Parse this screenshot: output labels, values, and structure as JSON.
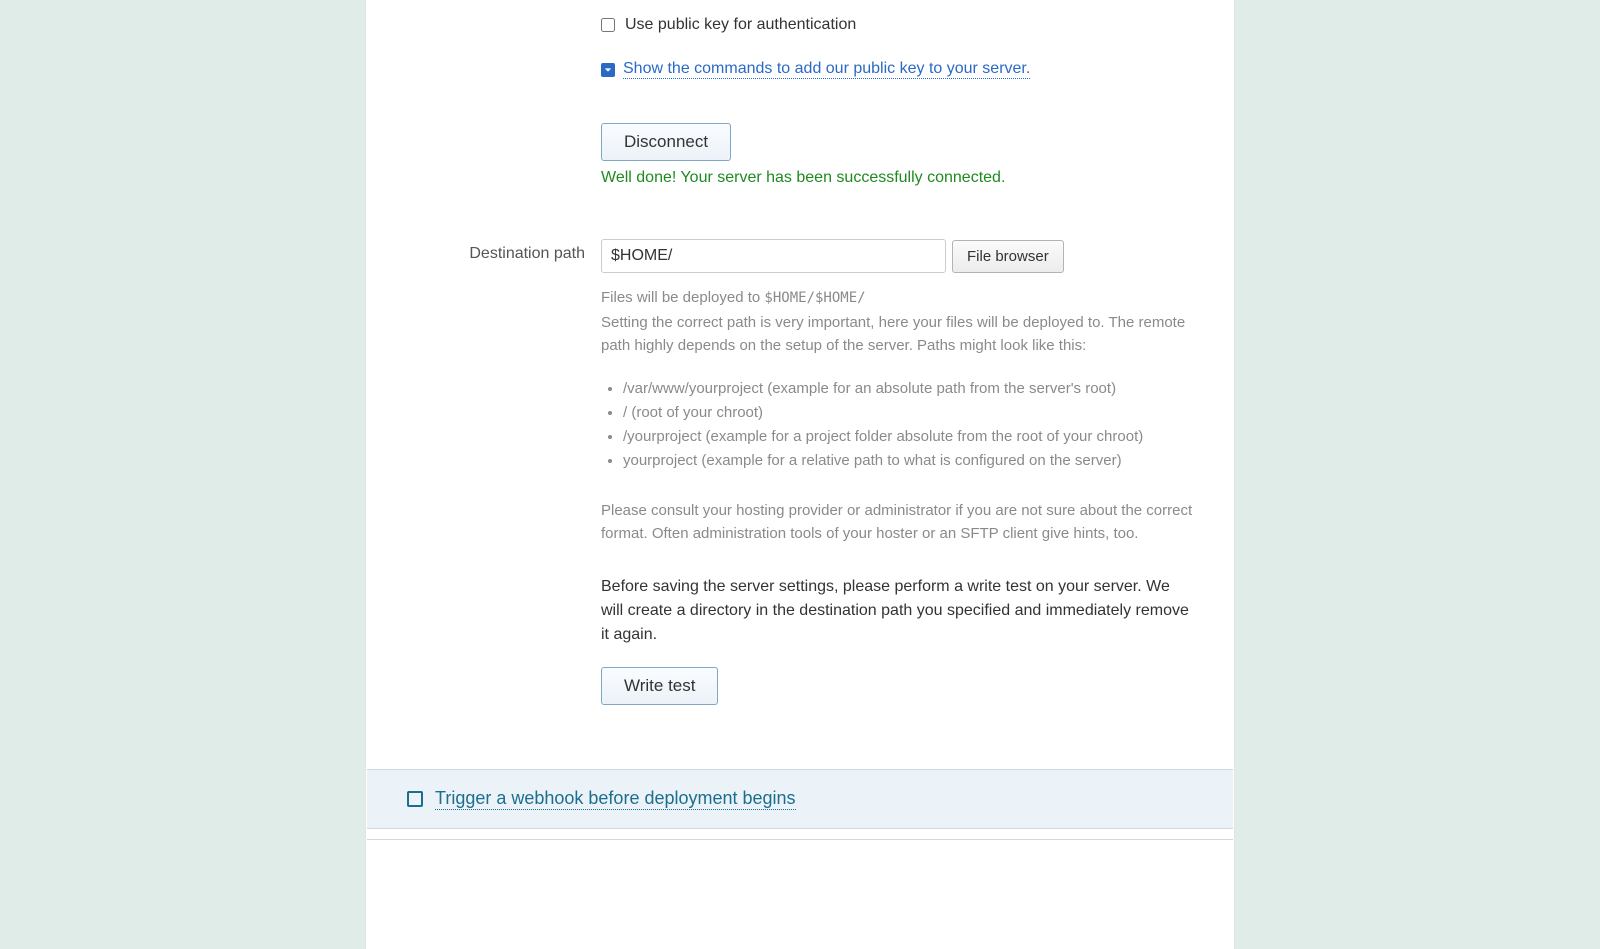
{
  "auth": {
    "public_key_checkbox_label": "Use public key for authentication",
    "show_commands_link": "Show the commands to add our public key to your server.",
    "disconnect_button_label": "Disconnect",
    "success_message": "Well done! Your server has been successfully connected."
  },
  "destination": {
    "label": "Destination path",
    "value": "$HOME/",
    "file_browser_button_label": "File browser",
    "deploy_preview_prefix": "Files will be deployed to ",
    "deploy_preview_path": "$HOME/$HOME/",
    "help_intro": "Setting the correct path is very important, here your files will be deployed to. The remote path highly depends on the setup of the server. Paths might look like this:",
    "examples": [
      "/var/www/yourproject (example for an absolute path from the server's root)",
      "/ (root of your chroot)",
      "/yourproject (example for a project folder absolute from the root of your chroot)",
      "yourproject (example for a relative path to what is configured on the server)"
    ],
    "help_footer": "Please consult your hosting provider or administrator if you are not sure about the correct format. Often administration tools of your hoster or an SFTP client give hints, too.",
    "write_test_intro": "Before saving the server settings, please perform a write test on your server. We will create a directory in the destination path you specified and immediately remove it again.",
    "write_test_button_label": "Write test"
  },
  "webhook": {
    "title": "Trigger a webhook before deployment begins"
  }
}
